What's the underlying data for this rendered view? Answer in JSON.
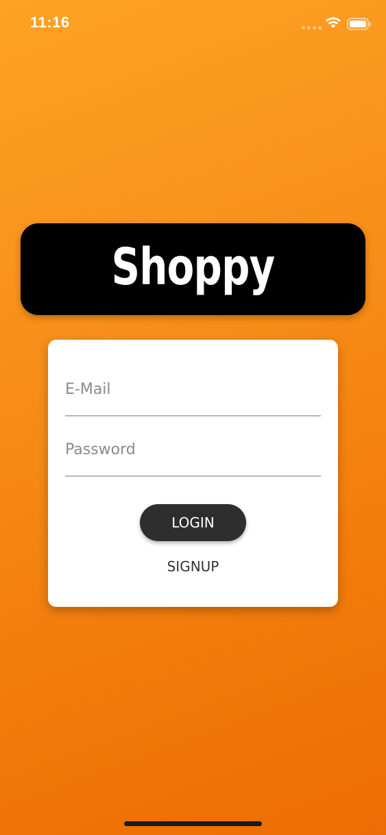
{
  "status_bar": {
    "time": "11:16"
  },
  "logo": {
    "text": "Shoppy"
  },
  "login_form": {
    "email": {
      "placeholder": "E-Mail",
      "value": ""
    },
    "password": {
      "placeholder": "Password",
      "value": ""
    },
    "login_label": "LOGIN",
    "signup_label": "SIGNUP"
  },
  "colors": {
    "background_top": "#fea223",
    "background_bottom": "#ee6c03",
    "logo_background": "#000000",
    "card_background": "#ffffff",
    "login_button": "#2e2e2e"
  },
  "icons": [
    "signal-icon",
    "wifi-icon",
    "battery-icon"
  ]
}
